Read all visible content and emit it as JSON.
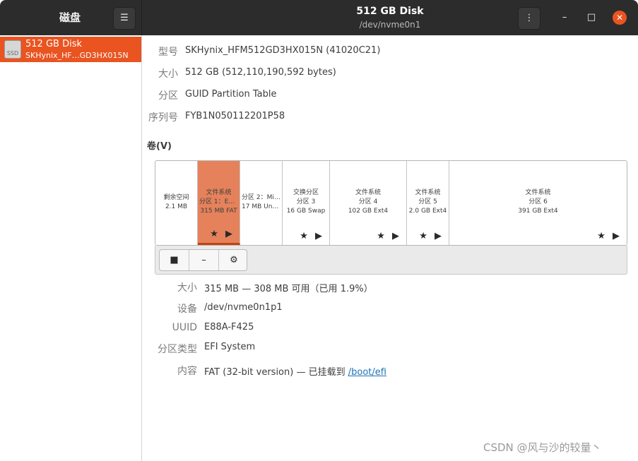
{
  "header": {
    "app_title": "磁盘",
    "menu_icon": "hamburger-icon",
    "disk_title": "512 GB Disk",
    "disk_path": "/dev/nvme0n1",
    "disk_menu_icon": "vertical-dots-icon",
    "minimize_icon": "minimize-icon",
    "maximize_icon": "maximize-icon",
    "close_icon": "close-icon",
    "accent_color": "#e95420"
  },
  "sidebar": {
    "items": [
      {
        "icon_text": "SSD",
        "name": "512 GB Disk",
        "model": "SKHynix_HF…GD3HX015N"
      }
    ]
  },
  "disk_info": {
    "model_label": "型号",
    "model_value": "SKHynix_HFM512GD3HX015N (41020C21)",
    "size_label": "大小",
    "size_value": "512 GB (512,110,190,592 bytes)",
    "partitioning_label": "分区",
    "partitioning_value": "GUID Partition Table",
    "serial_label": "序列号",
    "serial_value": "FYB1N050112201P58"
  },
  "volumes": {
    "heading": "卷(V)",
    "partitions": [
      {
        "line1": "剩余空间",
        "line2": "2.1 MB",
        "line3": "",
        "star": ""
      },
      {
        "line1": "文件系统",
        "line2": "分区 1：EFI…",
        "line3": "315 MB FAT",
        "star": "★ ▶"
      },
      {
        "line1": "分区 2：Mic…",
        "line2": "17 MB Unk…",
        "line3": "",
        "star": ""
      },
      {
        "line1": "交换分区",
        "line2": "分区 3",
        "line3": "16 GB Swap",
        "star": "★ ▶"
      },
      {
        "line1": "文件系统",
        "line2": "分区 4",
        "line3": "102 GB Ext4",
        "star": "★ ▶"
      },
      {
        "line1": "文件系统",
        "line2": "分区 5",
        "line3": "2.0 GB Ext4",
        "star": "★ ▶"
      },
      {
        "line1": "文件系统",
        "line2": "分区 6",
        "line3": "391 GB Ext4",
        "star": "★ ▶"
      }
    ],
    "toolbar": {
      "stop_icon": "■",
      "remove_icon": "–",
      "settings_icon": "⚙"
    }
  },
  "selected": {
    "size_label": "大小",
    "size_value": "315 MB — 308 MB 可用（已用 1.9%）",
    "device_label": "设备",
    "device_value": "/dev/nvme0n1p1",
    "uuid_label": "UUID",
    "uuid_value": "E88A-F425",
    "type_label": "分区类型",
    "type_value": "EFI System",
    "contents_label": "内容",
    "contents_value": "FAT (32-bit version) — 已挂载到 ",
    "mount_point": "/boot/efi"
  },
  "watermark": "CSDN @风与沙的较量丶"
}
